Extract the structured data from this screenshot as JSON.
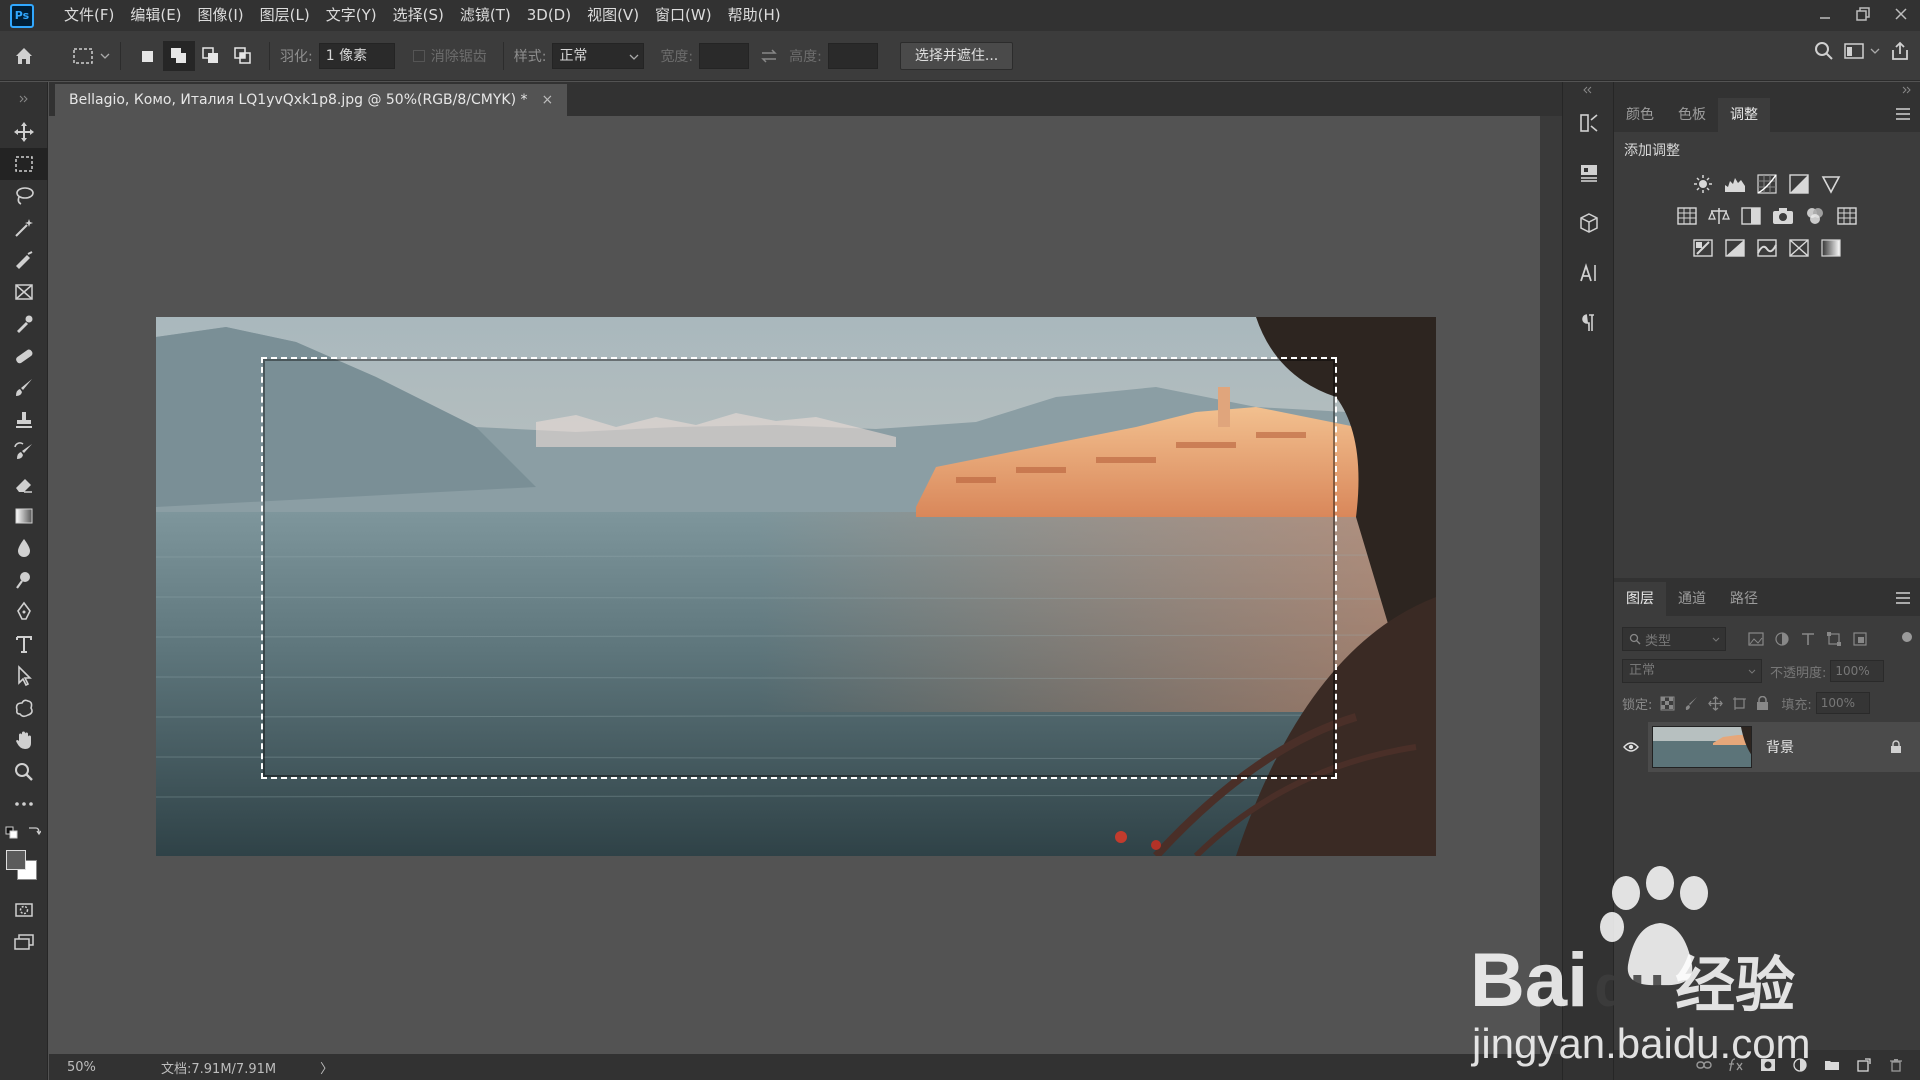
{
  "app": {
    "logo": "Ps"
  },
  "menu": [
    "文件(F)",
    "编辑(E)",
    "图像(I)",
    "图层(L)",
    "文字(Y)",
    "选择(S)",
    "滤镜(T)",
    "3D(D)",
    "视图(V)",
    "窗口(W)",
    "帮助(H)"
  ],
  "options": {
    "feather_label": "羽化:",
    "feather_value": "1 像素",
    "antialias_label": "消除锯齿",
    "style_label": "样式:",
    "style_value": "正常",
    "width_label": "宽度:",
    "height_label": "高度:",
    "select_mask_button": "选择并遮住..."
  },
  "document": {
    "tab_title": "Bellagio, Комо, Италия LQ1yvQxk1p8.jpg @ 50%(RGB/8/CMYK) *",
    "close": "×"
  },
  "status": {
    "zoom": "50%",
    "doc_size": "文档:7.91M/7.91M",
    "arrow": "〉"
  },
  "adjustments_panel": {
    "tabs": [
      "颜色",
      "色板",
      "调整"
    ],
    "active_tab": 2,
    "title": "添加调整"
  },
  "layers_panel": {
    "tabs": [
      "图层",
      "通道",
      "路径"
    ],
    "active_tab": 0,
    "filter_placeholder": "类型",
    "blend_mode": "正常",
    "opacity_label": "不透明度:",
    "opacity_value": "100%",
    "lock_label": "锁定:",
    "fill_label": "填充:",
    "fill_value": "100%",
    "layers": [
      {
        "name": "背景",
        "visible": true,
        "locked": true
      }
    ]
  },
  "watermark": {
    "brand_left": "Bai",
    "brand_mid": "du",
    "brand_right": "经验",
    "url": "jingyan.baidu.com"
  },
  "colors": {
    "accent": "#31a8ff",
    "menubar_bg": "#323232",
    "canvas_bg": "#535353",
    "panel_bg": "#3c3c3c"
  }
}
